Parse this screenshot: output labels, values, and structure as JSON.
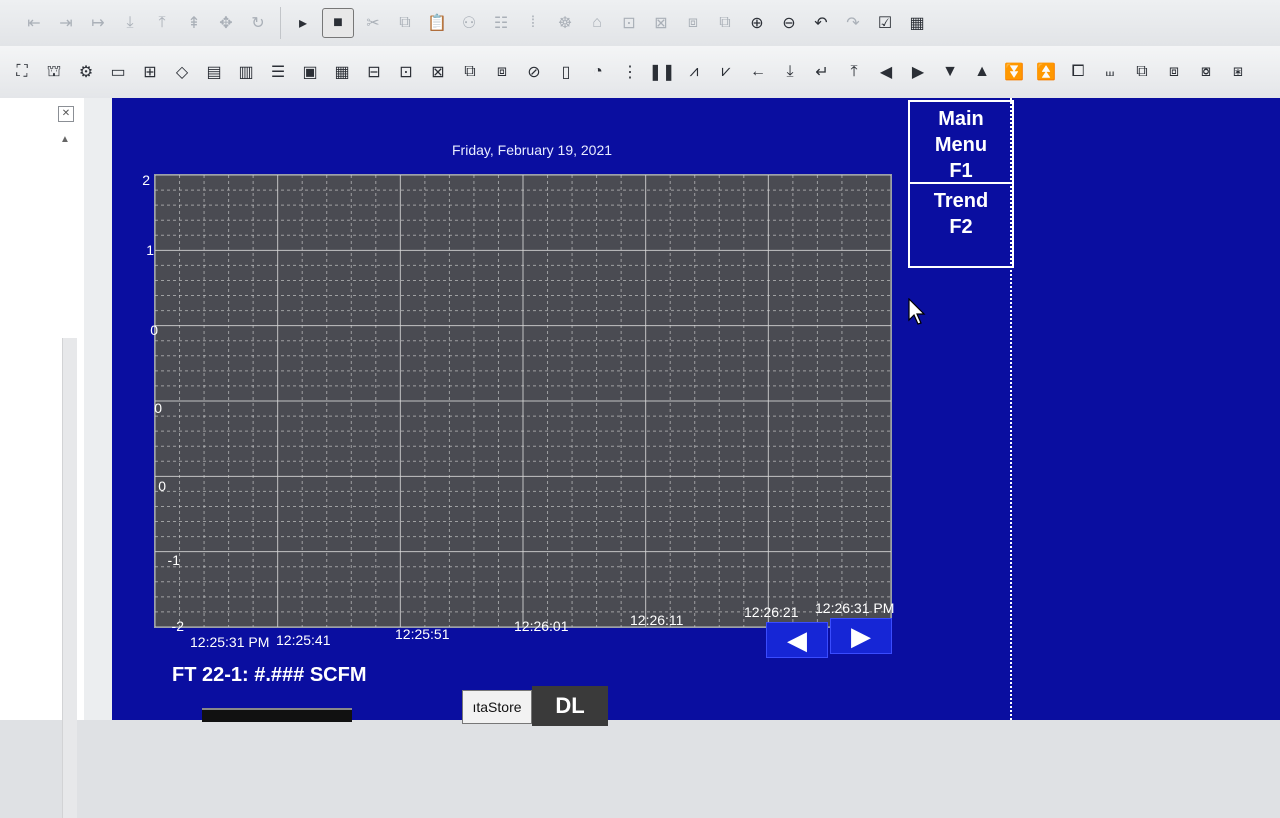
{
  "toolbar_row1": {
    "icons": [
      "step-icon",
      "step-icon",
      "step-icon",
      "step-icon",
      "step-icon",
      "step-icon",
      "step-icon",
      "step-icon",
      "play-icon",
      "stop-icon",
      "cut-icon",
      "copy-icon",
      "paste-icon",
      "group-icon",
      "align-icon",
      "align-icon",
      "tool-icon",
      "tool-icon",
      "tool-icon",
      "tool-icon",
      "tool-icon",
      "tool-icon",
      "zoom-in-icon",
      "zoom-out-icon",
      "undo-icon",
      "redo-icon",
      "properties-icon",
      "grid-icon"
    ]
  },
  "toolbar_row2": {
    "icons": [
      "object-icon",
      "object-icon",
      "object-icon",
      "object-icon",
      "object-icon",
      "object-icon",
      "object-icon",
      "object-icon",
      "object-icon",
      "object-icon",
      "object-icon",
      "object-icon",
      "object-icon",
      "object-icon",
      "object-icon",
      "object-icon",
      "object-icon",
      "chart-icon",
      "object-icon",
      "object-icon",
      "pause-icon",
      "trend-icon",
      "trend-icon",
      "arrow-left-icon",
      "arrow-down-icon",
      "enter-icon",
      "arrow-up-icon",
      "triangle-left-icon",
      "triangle-right-icon",
      "triangle-down-icon",
      "triangle-up-icon",
      "double-down-icon",
      "double-up-icon",
      "object-icon",
      "object-icon",
      "object-icon",
      "object-icon",
      "object-icon",
      "object-icon"
    ]
  },
  "hmi": {
    "date": "Friday, February 19, 2021",
    "y_ticks": [
      "2",
      "1",
      "0",
      "0",
      "0",
      "-1",
      "-2"
    ],
    "x_ticks": [
      "12:25:31 PM",
      "12:25:41",
      "12:25:51",
      "12:26:01",
      "12:26:11",
      "12:26:21",
      "12:26:31 PM"
    ],
    "main_menu_label": "Main Menu F1",
    "trend_label": "Trend F2",
    "prev_glyph": "◀",
    "next_glyph": "▶",
    "readout": "FT 22-1: #.### SCFM",
    "datastore_label": "ıtaStore",
    "dl_label": "DL"
  },
  "colors": {
    "screen_bg": "#0a0ea0",
    "plot_bg": "#4a4b52",
    "grid": "#d8d8d8"
  }
}
